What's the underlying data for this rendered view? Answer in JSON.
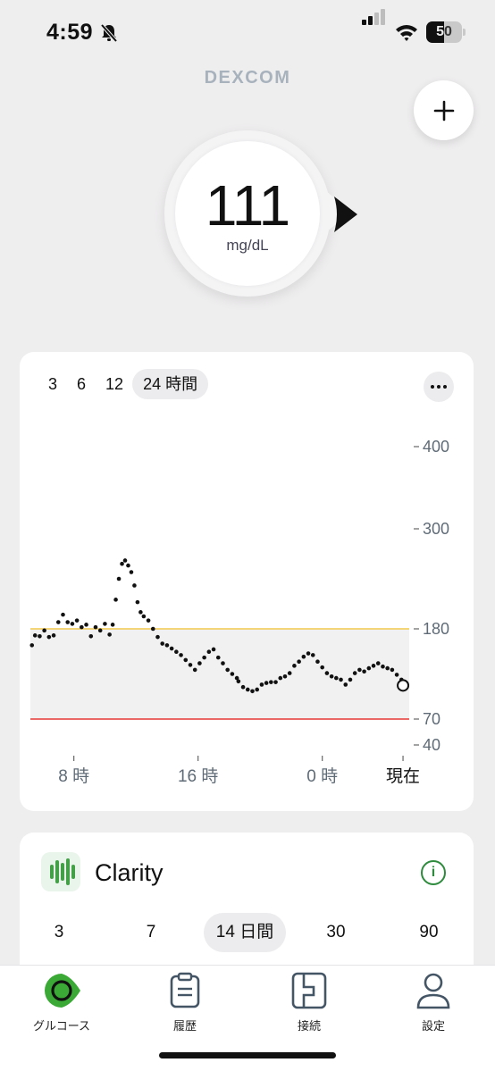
{
  "status_bar": {
    "time": "4:59",
    "battery": "50",
    "battery_level": 0.5
  },
  "brand": "DEXCOM",
  "glucose": {
    "value": "111",
    "unit": "mg/dL",
    "trend": "steady"
  },
  "graph": {
    "range_tabs": [
      "3",
      "6",
      "12",
      "24 時間"
    ],
    "active_range": "24 時間",
    "y_ticks": [
      "400",
      "300",
      "180",
      "70",
      "40"
    ],
    "x_ticks": [
      "8 時",
      "16 時",
      "0 時",
      "現在"
    ],
    "target_range": {
      "low": 70,
      "high": 180
    },
    "colors": {
      "high_line": "#f2c94c",
      "low_line": "#e53935",
      "range_band": "#f1f1f2",
      "points": "#111111"
    }
  },
  "chart_data": {
    "type": "scatter",
    "title": "",
    "xlabel": "",
    "ylabel": "",
    "x_unit": "hours",
    "x_ticks": [
      {
        "x": 8,
        "label": "8 時"
      },
      {
        "x": 16,
        "label": "16 時"
      },
      {
        "x": 24,
        "label": "0 時"
      },
      {
        "x": 29.2,
        "label": "現在"
      }
    ],
    "y_ticks": [
      400,
      300,
      180,
      70,
      40
    ],
    "ylim": [
      40,
      400
    ],
    "xlim": [
      5.2,
      29.6
    ],
    "series": [
      {
        "values": [
          [
            5.3,
            160
          ],
          [
            5.5,
            172
          ],
          [
            5.8,
            171
          ],
          [
            6.1,
            178
          ],
          [
            6.4,
            170
          ],
          [
            6.7,
            172
          ],
          [
            7.0,
            188
          ],
          [
            7.3,
            197
          ],
          [
            7.6,
            188
          ],
          [
            7.9,
            186
          ],
          [
            8.2,
            190
          ],
          [
            8.5,
            182
          ],
          [
            8.8,
            185
          ],
          [
            9.1,
            171
          ],
          [
            9.4,
            182
          ],
          [
            9.7,
            178
          ],
          [
            10.0,
            186
          ],
          [
            10.3,
            173
          ],
          [
            10.5,
            185
          ],
          [
            10.7,
            215
          ],
          [
            10.9,
            240
          ],
          [
            11.1,
            258
          ],
          [
            11.3,
            262
          ],
          [
            11.5,
            256
          ],
          [
            11.7,
            248
          ],
          [
            11.9,
            232
          ],
          [
            12.1,
            212
          ],
          [
            12.3,
            200
          ],
          [
            12.5,
            195
          ],
          [
            12.8,
            190
          ],
          [
            13.1,
            180
          ],
          [
            13.4,
            170
          ],
          [
            13.7,
            162
          ],
          [
            14.0,
            160
          ],
          [
            14.3,
            156
          ],
          [
            14.6,
            152
          ],
          [
            14.9,
            148
          ],
          [
            15.2,
            142
          ],
          [
            15.5,
            136
          ],
          [
            15.8,
            130
          ],
          [
            16.1,
            138
          ],
          [
            16.4,
            145
          ],
          [
            16.7,
            152
          ],
          [
            17.0,
            155
          ],
          [
            17.3,
            145
          ],
          [
            17.6,
            138
          ],
          [
            17.9,
            130
          ],
          [
            18.2,
            125
          ],
          [
            18.5,
            120
          ],
          [
            18.6,
            116
          ],
          [
            18.9,
            109
          ],
          [
            19.2,
            106
          ],
          [
            19.5,
            104
          ],
          [
            19.8,
            106
          ],
          [
            20.1,
            112
          ],
          [
            20.4,
            114
          ],
          [
            20.7,
            115
          ],
          [
            21.0,
            115
          ],
          [
            21.3,
            120
          ],
          [
            21.6,
            122
          ],
          [
            21.9,
            126
          ],
          [
            22.2,
            135
          ],
          [
            22.5,
            140
          ],
          [
            22.8,
            146
          ],
          [
            23.1,
            150
          ],
          [
            23.4,
            148
          ],
          [
            23.7,
            140
          ],
          [
            24.0,
            133
          ],
          [
            24.3,
            126
          ],
          [
            24.6,
            122
          ],
          [
            24.9,
            120
          ],
          [
            25.2,
            118
          ],
          [
            25.5,
            112
          ],
          [
            25.8,
            118
          ],
          [
            26.1,
            126
          ],
          [
            26.4,
            130
          ],
          [
            26.7,
            128
          ],
          [
            27.0,
            132
          ],
          [
            27.3,
            135
          ],
          [
            27.6,
            138
          ],
          [
            27.9,
            134
          ],
          [
            28.2,
            132
          ],
          [
            28.5,
            130
          ],
          [
            28.8,
            124
          ],
          [
            29.1,
            118
          ]
        ]
      }
    ],
    "current": {
      "x": 29.2,
      "y": 111
    }
  },
  "clarity": {
    "title": "Clarity",
    "tabs": [
      "3",
      "7",
      "14 日間",
      "30",
      "90"
    ],
    "active_tab": "14 日間"
  },
  "tab_bar": {
    "items": [
      {
        "label": "グルコース",
        "icon": "glucose-icon"
      },
      {
        "label": "履歴",
        "icon": "history-icon"
      },
      {
        "label": "接続",
        "icon": "connection-icon"
      },
      {
        "label": "設定",
        "icon": "settings-icon"
      }
    ],
    "active": "グルコース"
  }
}
